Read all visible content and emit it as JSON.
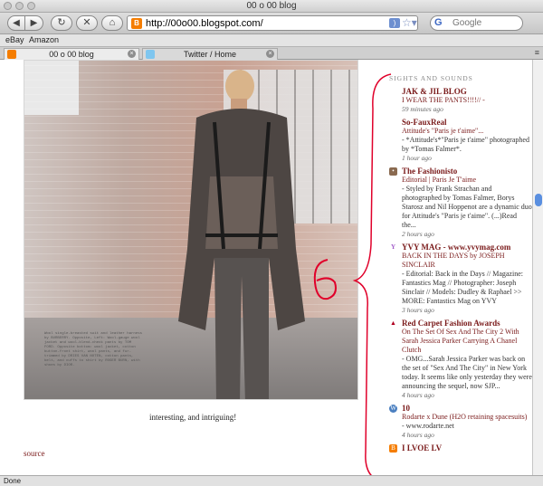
{
  "window": {
    "title": "00 o 00 blog"
  },
  "toolbar": {
    "back_label": "◀",
    "forward_label": "▶",
    "reload_label": "↻",
    "stop_label": "✕",
    "home_label": "⌂",
    "url": "http://00o00.blogspot.com/",
    "search_placeholder": "Google",
    "search_engine": "G"
  },
  "bookmarks": [
    "eBay",
    "Amazon"
  ],
  "tabs": [
    {
      "label": "00 o 00 blog",
      "active": true,
      "icon_color": "#f57d00"
    },
    {
      "label": "Twitter / Home",
      "active": false,
      "icon_color": "#7fc6ef"
    }
  ],
  "post": {
    "photo_caption": "Wool single-breasted suit and leather harness by BURBERRY. Opposite, Left: Wool-gauge wool jacket and wool-blend-check pants by TOM FORD. Opposite bottom: wool jacket, cotton button-front shirt, wool pants, and fur-trimmed by DRIES VAN NOTEN, cotton pants, belt, and cuffs to shirt by ROGER BURN, with shoes by DIOR.",
    "caption": "interesting, and intriguing!",
    "source_label": "source"
  },
  "sidebar": {
    "heading": "SIGHTS AND SOUNDS",
    "items": [
      {
        "blog": "JAK & JIL BLOG",
        "title": "I WEAR THE PANTS!!!!// -",
        "snippet": "",
        "time": "59 minutes ago",
        "icon": ""
      },
      {
        "blog": "So-FauxReal",
        "title": "Attitude's \"Paris je t'aime\"...",
        "snippet": "- *Attitude's*\"Paris je t'aime\" photographed by *Tomas Falmer*.",
        "time": "1 hour ago",
        "icon": ""
      },
      {
        "blog": "The Fashionisto",
        "title": "Editorial | Paris Je T'aime",
        "snippet": "- Styled by Frank Strachan and photographed by Tomas Falmer, Borys Starosz and Nil Hoppenot are a dynamic duo for Attitude's \"Paris je t'aime\". (...)Read the...",
        "time": "2 hours ago",
        "icon": "person"
      },
      {
        "blog": "YVY MAG - www.yvymag.com",
        "title": "BACK IN THE DAYS by JOSEPH SINCLAIR",
        "snippet": "- Editorial: Back in the Days // Magazine: Fantastics Mag // Photographer: Joseph Sinclair // Models: Dudley & Raphael >> MORE: Fantastics Mag on YVY",
        "time": "3 hours ago",
        "icon": "Y"
      },
      {
        "blog": "Red Carpet Fashion Awards",
        "title": "On The Set Of Sex And The City 2 With Sarah Jessica Parker Carrying A Chanel Clutch",
        "snippet": "- OMG...Sarah Jessica Parker was back on the set of \"Sex And The City\" in New York today. It seems like only yesterday they were announcing the sequel, now SJP...",
        "time": "4 hours ago",
        "icon": "shoe"
      },
      {
        "blog": "10",
        "title": "Rodarte x Dune (H2O retaining spacesuits)",
        "snippet": "- www.rodarte.net",
        "time": "4 hours ago",
        "icon": "W"
      },
      {
        "blog": "I LVOE LV",
        "title": "",
        "snippet": "",
        "time": "",
        "icon": "B"
      }
    ]
  },
  "annotation": {
    "label": "6",
    "color": "#e0002a"
  },
  "status": {
    "text": "Done"
  }
}
